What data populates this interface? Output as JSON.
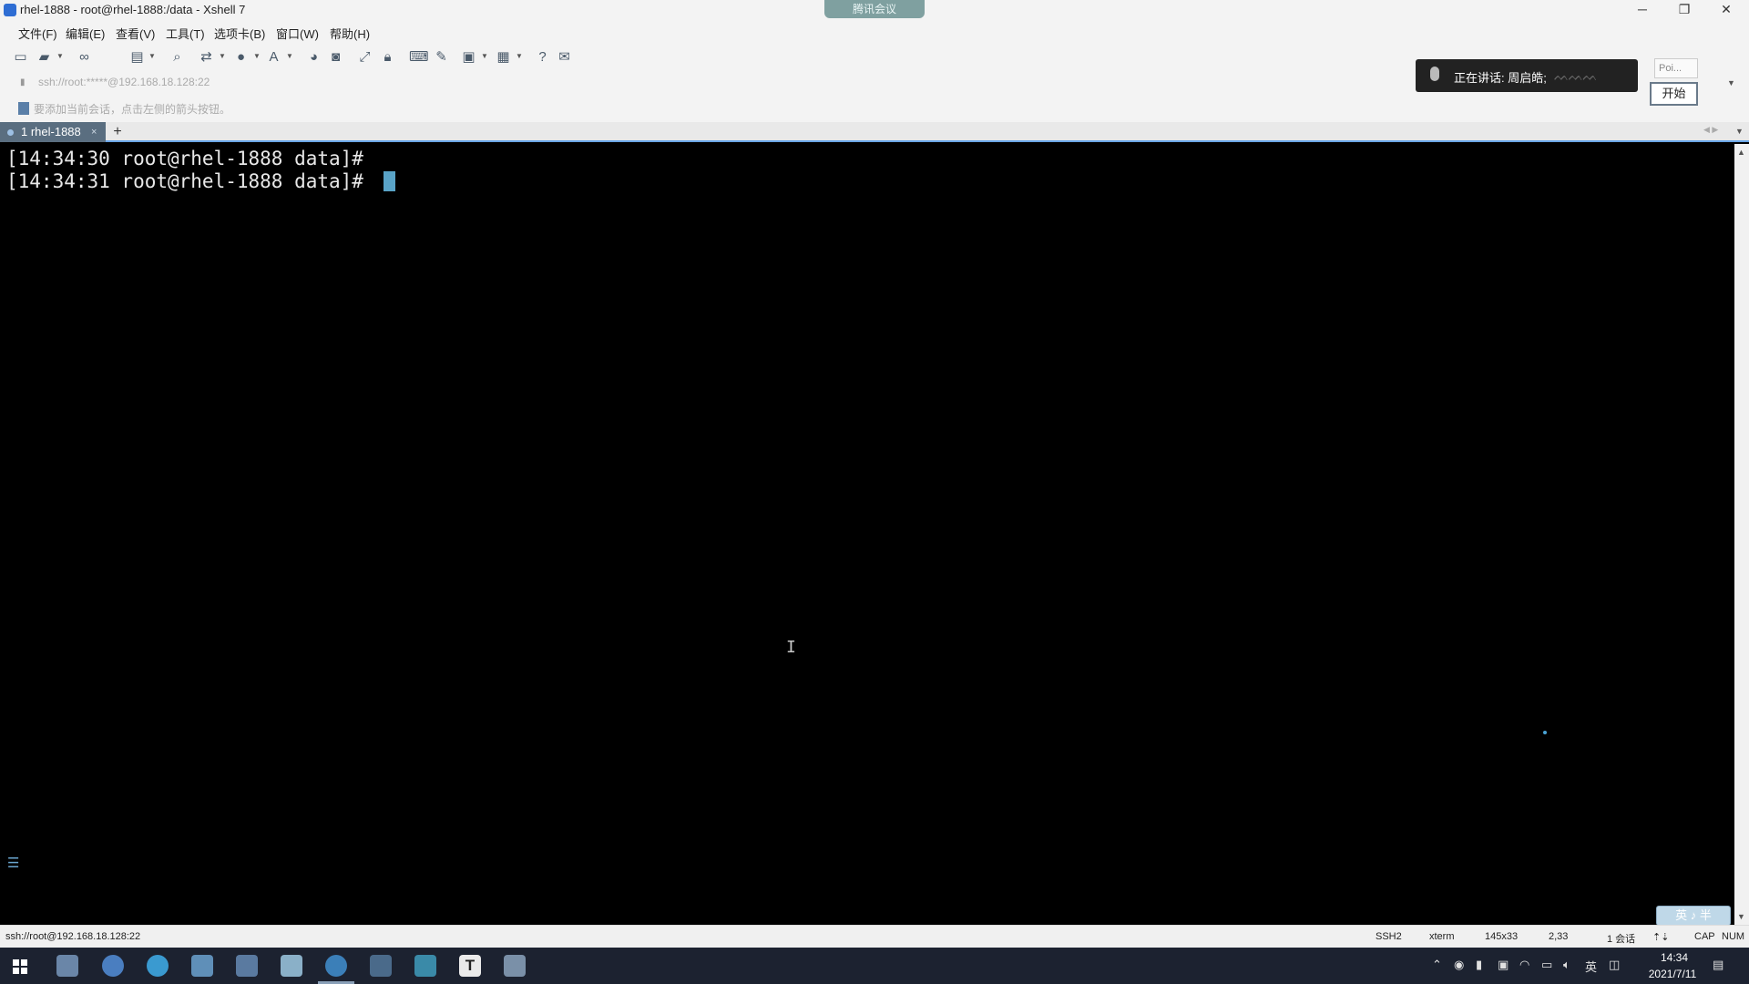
{
  "window": {
    "title": "rhel-1888 - root@rhel-1888:/data - Xshell 7",
    "meeting_pill": "腾讯会议"
  },
  "menu": [
    "文件(F)",
    "编辑(E)",
    "查看(V)",
    "工具(T)",
    "选项卡(B)",
    "窗口(W)",
    "帮助(H)"
  ],
  "address": "ssh://root:*****@192.168.18.128:22",
  "hint": "要添加当前会话，点击左侧的箭头按钮。",
  "meeting": {
    "speaking_text": "正在讲话: 周启皓;",
    "poi_label": "Poi...",
    "start_button": "开始"
  },
  "tabs": [
    {
      "label": "1 rhel-1888",
      "close": "×"
    }
  ],
  "add_tab": "+",
  "terminal": {
    "lines": [
      "[14:34:30 root@rhel-1888 data]#",
      "[14:34:31 root@rhel-1888 data]# "
    ]
  },
  "ime": "英 ♪ 半",
  "status": {
    "connection": "ssh://root@192.168.18.128:22",
    "protocol": "SSH2",
    "term": "xterm",
    "size": "145x33",
    "position": "2,33",
    "sessions": "1 会话",
    "caps": "CAP",
    "num": "NUM"
  },
  "taskbar": {
    "time": "14:34",
    "date": "2021/7/11",
    "lang": "英"
  },
  "colors": {
    "terminal_bg": "#000000",
    "terminal_fg": "#e8e8e8",
    "cursor": "#59a3c7",
    "tab_active": "#5a6e80",
    "taskbar": "#1c2230"
  }
}
